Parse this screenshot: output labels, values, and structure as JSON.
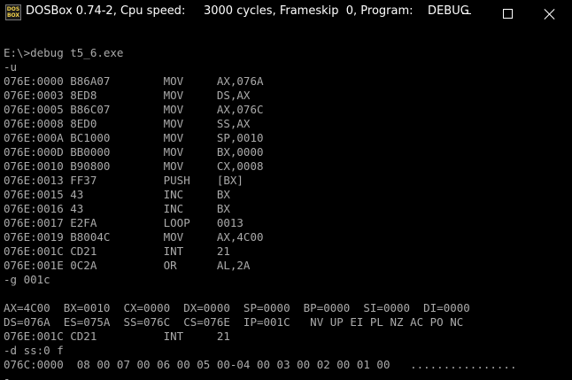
{
  "window": {
    "title": "DOSBox 0.74-2, Cpu speed:     3000 cycles, Frameskip  0, Program:    DEBUG",
    "icon_text": "DOS\nBOX",
    "icon": "dosbox-icon",
    "controls": [
      "minimize-icon",
      "maximize-icon",
      "close-icon"
    ]
  },
  "terminal": {
    "lines": [
      "",
      "E:\\>debug t5_6.exe",
      "-u",
      "076E:0000 B86A07        MOV     AX,076A",
      "076E:0003 8ED8          MOV     DS,AX",
      "076E:0005 B86C07        MOV     AX,076C",
      "076E:0008 8ED0          MOV     SS,AX",
      "076E:000A BC1000        MOV     SP,0010",
      "076E:000D BB0000        MOV     BX,0000",
      "076E:0010 B90800        MOV     CX,0008",
      "076E:0013 FF37          PUSH    [BX]",
      "076E:0015 43            INC     BX",
      "076E:0016 43            INC     BX",
      "076E:0017 E2FA          LOOP    0013",
      "076E:0019 B8004C        MOV     AX,4C00",
      "076E:001C CD21          INT     21",
      "076E:001E 0C2A          OR      AL,2A",
      "-g 001c",
      "",
      "AX=4C00  BX=0010  CX=0000  DX=0000  SP=0000  BP=0000  SI=0000  DI=0000",
      "DS=076A  ES=075A  SS=076C  CS=076E  IP=001C   NV UP EI PL NZ AC PO NC",
      "076E:001C CD21          INT     21",
      "-d ss:0 f",
      "076C:0000  08 00 07 00 06 00 05 00-04 00 03 00 02 00 01 00   ................",
      "-"
    ],
    "text_color": "#aaaaaa",
    "background": "#000000"
  }
}
